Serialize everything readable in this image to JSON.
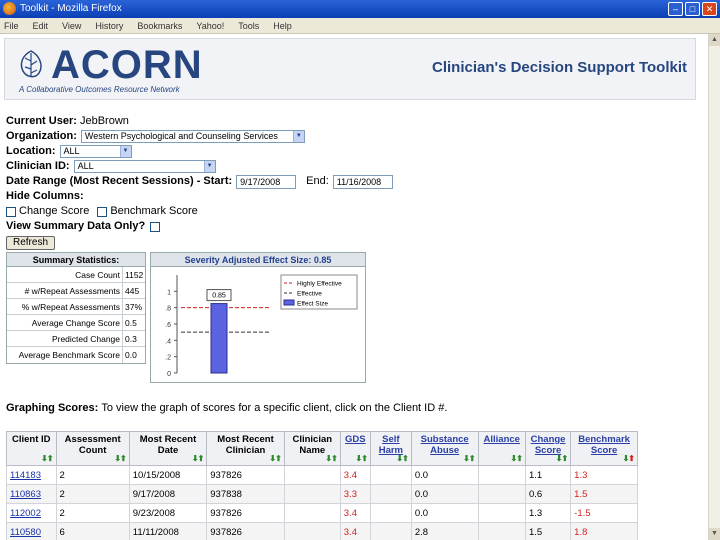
{
  "window": {
    "title": "Toolkit - Mozilla Firefox"
  },
  "menu": [
    "File",
    "Edit",
    "View",
    "History",
    "Bookmarks",
    "Yahoo!",
    "Tools",
    "Help"
  ],
  "header": {
    "logo_word": "ACORN",
    "logo_tagline": "A Collaborative Outcomes Resource Network",
    "title": "Clinician's Decision Support Toolkit"
  },
  "form": {
    "current_user_label": "Current User:",
    "current_user": "JebBrown",
    "organization_label": "Organization:",
    "organization": "Western Psychological and Counseling Services",
    "location_label": "Location:",
    "location": "ALL",
    "clinician_label": "Clinician ID:",
    "clinician": "ALL",
    "date_range_label": "Date Range (Most Recent Sessions) - Start:",
    "start_date": "9/17/2008",
    "end_label": "End:",
    "end_date": "11/16/2008",
    "hide_columns_label": "Hide Columns:",
    "change_score_label": "Change Score",
    "benchmark_score_label": "Benchmark Score",
    "summary_only_label": "View Summary Data Only?",
    "refresh_label": "Refresh"
  },
  "summary": {
    "title": "Summary Statistics:",
    "rows": [
      {
        "label": "Case Count",
        "value": "1152"
      },
      {
        "label": "# w/Repeat Assessments",
        "value": "445"
      },
      {
        "label": "% w/Repeat Assessments",
        "value": "37%"
      },
      {
        "label": "Average Change Score",
        "value": "0.5"
      },
      {
        "label": "Predicted Change",
        "value": "0.3"
      },
      {
        "label": "Average Benchmark Score",
        "value": "0.0"
      }
    ]
  },
  "chart_data": {
    "type": "bar",
    "title": "Severity Adjusted Effect Size: 0.85",
    "categories": [
      ""
    ],
    "series": [
      {
        "name": "Effect Size",
        "values": [
          0.85
        ]
      }
    ],
    "data_label": "0.85",
    "ylim": [
      0,
      1.2
    ],
    "yticks": [
      "0",
      ".2",
      ".4",
      ".6",
      ".8",
      "1"
    ],
    "reference_lines": [
      {
        "name": "Highly Effective",
        "value": 0.8,
        "color": "#cc2222"
      },
      {
        "name": "Effective",
        "value": 0.5,
        "color": "#333333"
      }
    ],
    "legend": [
      "Highly Effective",
      "Effective",
      "Effect Size"
    ],
    "bar_color": "#5b63e0"
  },
  "graphing": {
    "label": "Graphing Scores:",
    "text": "To view the graph of scores for a specific client, click on the Client ID #."
  },
  "table": {
    "columns": [
      {
        "label": "Client ID",
        "link": false,
        "arrows": "down-up"
      },
      {
        "label": "Assessment Count",
        "link": false,
        "arrows": "down-up"
      },
      {
        "label": "Most Recent Date",
        "link": false,
        "arrows": "down-up"
      },
      {
        "label": "Most Recent Clinician",
        "link": false,
        "arrows": "down-up"
      },
      {
        "label": "Clinician Name",
        "link": false,
        "arrows": "down-up"
      },
      {
        "label": "GDS",
        "link": true,
        "arrows": "down-up"
      },
      {
        "label": "Self Harm",
        "link": true,
        "arrows": "down-up"
      },
      {
        "label": "Substance Abuse",
        "link": true,
        "arrows": "down-up"
      },
      {
        "label": "Alliance",
        "link": true,
        "arrows": "down-up"
      },
      {
        "label": "Change Score",
        "link": true,
        "arrows": "down-up"
      },
      {
        "label": "Benchmark Score",
        "link": true,
        "arrows": "down-up-red"
      }
    ],
    "rows": [
      [
        "114183",
        "2",
        "10/15/2008",
        "937826",
        "",
        "3.4",
        "",
        "0.0",
        "",
        "1.1",
        "1.3"
      ],
      [
        "110863",
        "2",
        "9/17/2008",
        "937838",
        "",
        "3.3",
        "",
        "0.0",
        "",
        "0.6",
        "1.5"
      ],
      [
        "112002",
        "2",
        "9/23/2008",
        "937826",
        "",
        "3.4",
        "",
        "0.0",
        "",
        "1.3",
        "-1.5"
      ],
      [
        "110580",
        "6",
        "11/11/2008",
        "937826",
        "",
        "3.4",
        "",
        "2.8",
        "",
        "1.5",
        "1.8"
      ]
    ]
  }
}
